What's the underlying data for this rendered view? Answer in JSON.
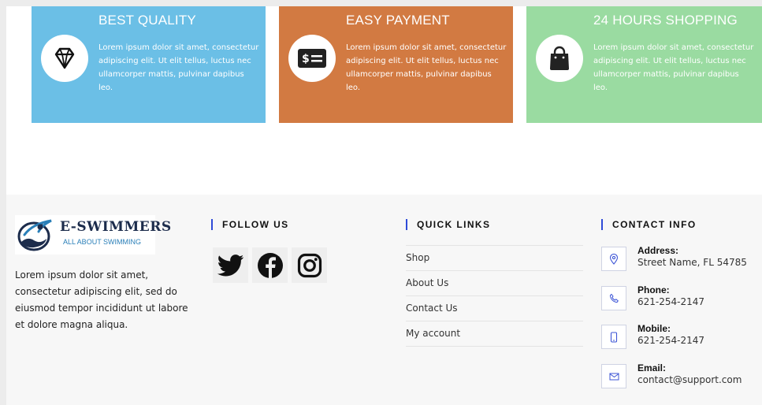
{
  "features": [
    {
      "title": "BEST QUALITY",
      "text": "Lorem ipsum dolor sit amet, consectetur adipiscing elit. Ut elit tellus, luctus nec ullamcorper mattis, pulvinar dapibus leo.",
      "color": "#6bbfe6",
      "icon": "diamond-icon"
    },
    {
      "title": "EASY PAYMENT",
      "text": "Lorem ipsum dolor sit amet, consectetur adipiscing elit. Ut elit tellus, luctus nec ullamcorper mattis, pulvinar dapibus leo.",
      "color": "#d27a42",
      "icon": "money-bill-icon"
    },
    {
      "title": "24 HOURS SHOPPING",
      "text": "Lorem ipsum dolor sit amet, consectetur adipiscing elit. Ut elit tellus, luctus nec ullamcorper mattis, pulvinar dapibus leo.",
      "color": "#9adba1",
      "icon": "shopping-bag-icon"
    }
  ],
  "footer": {
    "brand": {
      "name": "E-SWIMMERS",
      "tagline": "ALL ABOUT SWIMMING"
    },
    "about": "Lorem ipsum dolor sit amet, consectetur adipiscing elit, sed do eiusmod tempor incididunt ut labore et dolore magna aliqua.",
    "follow_heading": "FOLLOW US",
    "social": [
      "twitter-icon",
      "facebook-icon",
      "instagram-icon"
    ],
    "links_heading": "QUICK LINKS",
    "links": [
      "Shop",
      "About Us",
      "Contact Us",
      "My account"
    ],
    "contact_heading": "CONTACT INFO",
    "contact": [
      {
        "label": "Address:",
        "value": "Street Name, FL 54785",
        "icon": "map-pin-icon"
      },
      {
        "label": "Phone:",
        "value": "621-254-2147",
        "icon": "phone-icon"
      },
      {
        "label": "Mobile:",
        "value": "621-254-2147",
        "icon": "mobile-icon"
      },
      {
        "label": "Email:",
        "value": "contact@support.com",
        "icon": "envelope-icon"
      }
    ],
    "accent": "#2f4bd8"
  }
}
